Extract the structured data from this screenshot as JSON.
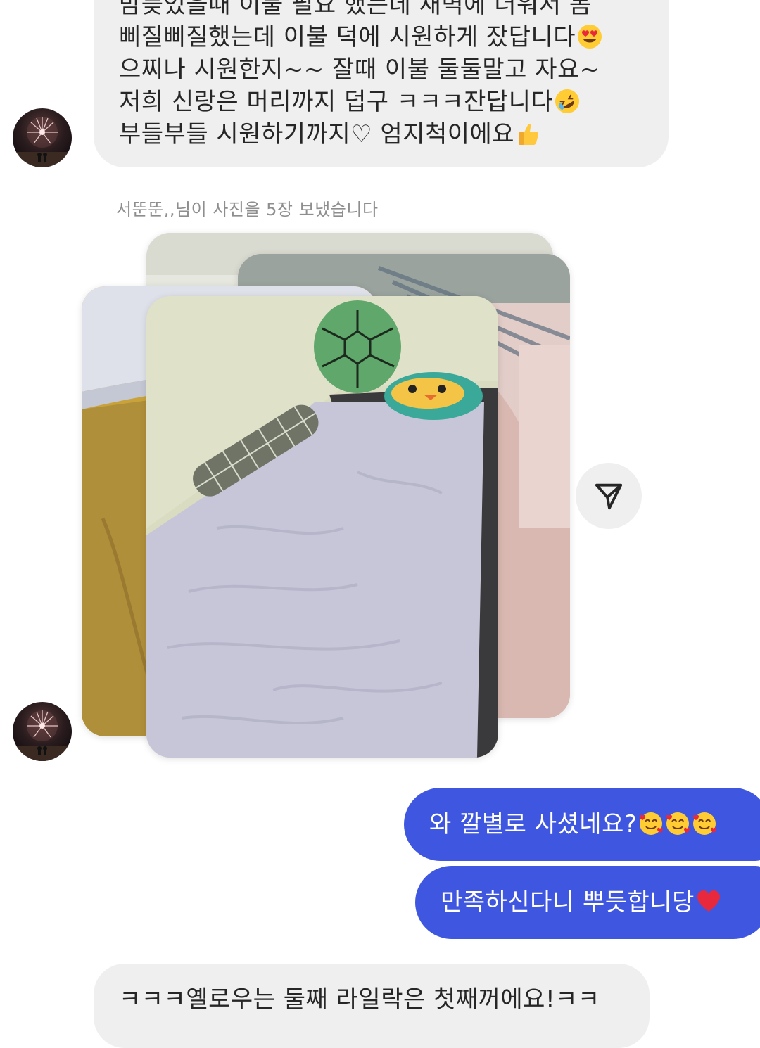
{
  "conversation": {
    "incoming_top": {
      "line_clipped": "밤늦었을때 이불 필요 했는데 새벽에 더워서 몸",
      "line_1": "삐질삐질했는데 이불 덕에 시원하게 잤답니다",
      "line_1_emoji": "heart-eyes-emoji",
      "line_2": "으찌나 시원한지~~ 잘때 이불 둘둘말고 자요~",
      "line_3": "저희 신랑은 머리까지 덥구 ㅋㅋㅋ잔답니다",
      "line_3_emoji": "rolling-laughing-emoji",
      "line_4": "부들부들 시원하기까지♡ 엄지척이에요",
      "line_4_emoji": "thumbs-up-emoji"
    },
    "photo_notice": "서뚠뚠,,님이 사진을 5장 보냈습니다",
    "photo_count": 5,
    "share_icon": "send-icon",
    "outgoing": [
      {
        "text": "와 깔별로 사셨네요?",
        "emoji": "smiling-hearts-emoji",
        "emoji_count": 3
      },
      {
        "text": "만족하신다니 뿌듯합니당",
        "emoji": "red-heart-emoji",
        "emoji_count": 1
      }
    ],
    "incoming_bottom": {
      "line_1": "ㅋㅋㅋ옐로우는 둘째 라일락은 첫째꺼에요!ㅋㅋ"
    }
  },
  "colors": {
    "incoming_bubble": "#efefef",
    "outgoing_bubble": "#3f57e0",
    "notice_text": "#8e8e8e",
    "text": "#262626"
  }
}
